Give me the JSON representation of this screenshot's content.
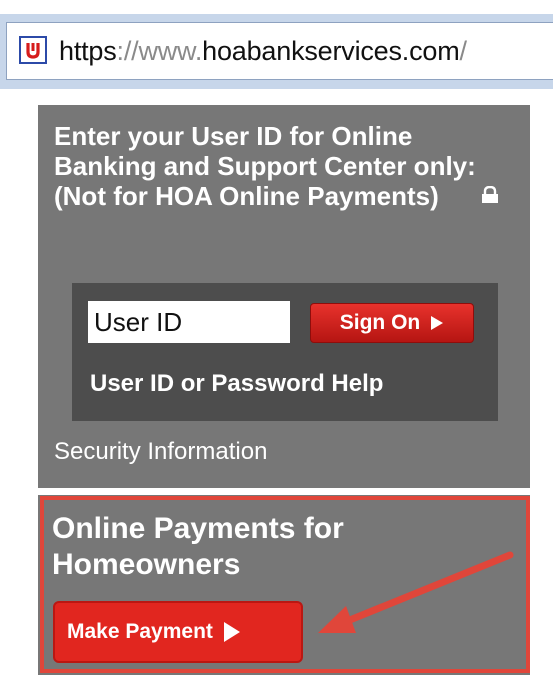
{
  "browser": {
    "favicon": "hoa-bank-favicon",
    "url": {
      "scheme": "https",
      "separator": "://",
      "subdomain": "www.",
      "domain": "hoabankservices.com",
      "path": "/"
    }
  },
  "signin": {
    "heading": "Enter your User ID for Online Banking and Support Center only: (Not for HOA Online Payments)",
    "lock_icon": "lock-icon",
    "userid_placeholder": "User ID",
    "signon_label": "Sign On",
    "help_link": "User ID or Password Help",
    "security_link": "Security Information"
  },
  "payments": {
    "heading": "Online Payments for Homeowners",
    "button_label": "Make Payment"
  },
  "colors": {
    "panel_bg": "#777777",
    "inner_box_bg": "#4d4d4d",
    "button_red": "#e1261f",
    "annotation_red": "#e0463a",
    "address_bar": "#c7d6ea"
  }
}
